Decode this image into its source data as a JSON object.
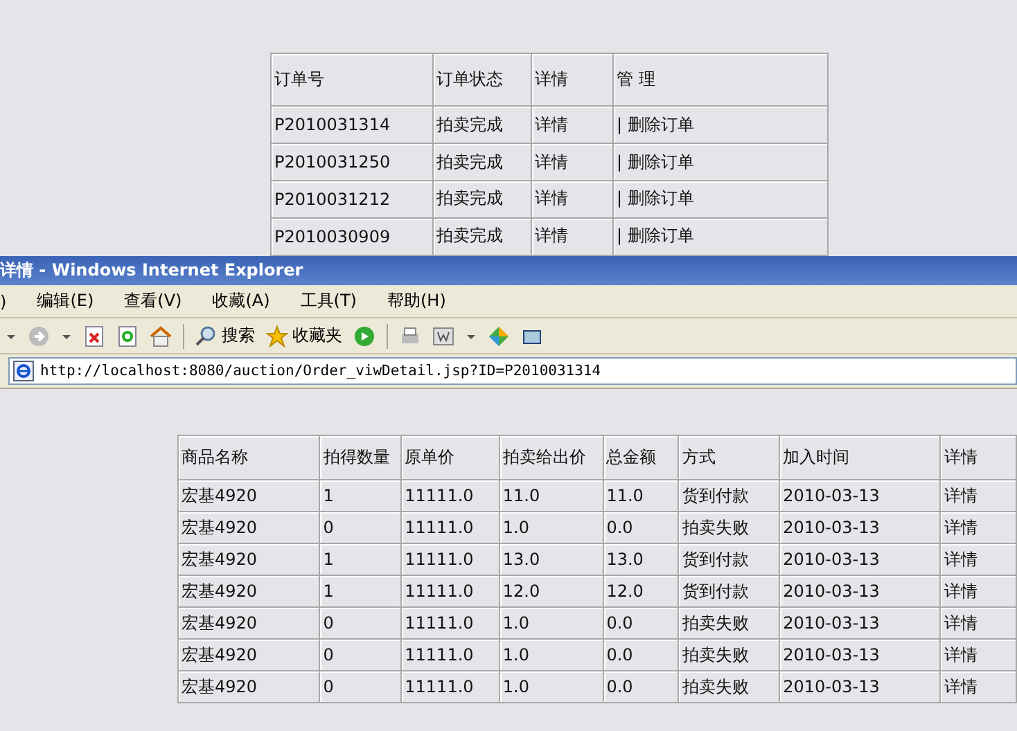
{
  "orders_table": {
    "columns": [
      "订单号",
      "订单状态",
      "详情",
      "管 理"
    ],
    "rows": [
      {
        "order_no": "P2010031314",
        "status": "拍卖完成",
        "detail": "详情",
        "manage": "| 删除订单"
      },
      {
        "order_no": "P2010031250",
        "status": "拍卖完成",
        "detail": "详情",
        "manage": "| 删除订单"
      },
      {
        "order_no": "P2010031212",
        "status": "拍卖完成",
        "detail": "详情",
        "manage": "| 删除订单"
      },
      {
        "order_no": "P2010030909",
        "status": "拍卖完成",
        "detail": "详情",
        "manage": "| 删除订单"
      }
    ]
  },
  "window": {
    "title": "详情 - Windows Internet Explorer"
  },
  "menu": [
    ")",
    "编辑(E)",
    "查看(V)",
    "收藏(A)",
    "工具(T)",
    "帮助(H)"
  ],
  "toolbar": {
    "search": "搜索",
    "favorites": "收藏夹"
  },
  "address": "http://localhost:8080/auction/Order_viwDetail.jsp?ID=P2010031314",
  "detail_table": {
    "columns": [
      "商品名称",
      "拍得数量",
      "原单价",
      "拍卖给出价",
      "总金额",
      "方式",
      "加入时间",
      "详情"
    ],
    "rows": [
      [
        "宏基4920",
        "1",
        "11111.0",
        "11.0",
        "11.0",
        "货到付款",
        "2010-03-13",
        "详情"
      ],
      [
        "宏基4920",
        "0",
        "11111.0",
        "1.0",
        "0.0",
        "拍卖失败",
        "2010-03-13",
        "详情"
      ],
      [
        "宏基4920",
        "1",
        "11111.0",
        "13.0",
        "13.0",
        "货到付款",
        "2010-03-13",
        "详情"
      ],
      [
        "宏基4920",
        "1",
        "11111.0",
        "12.0",
        "12.0",
        "货到付款",
        "2010-03-13",
        "详情"
      ],
      [
        "宏基4920",
        "0",
        "11111.0",
        "1.0",
        "0.0",
        "拍卖失败",
        "2010-03-13",
        "详情"
      ],
      [
        "宏基4920",
        "0",
        "11111.0",
        "1.0",
        "0.0",
        "拍卖失败",
        "2010-03-13",
        "详情"
      ],
      [
        "宏基4920",
        "0",
        "11111.0",
        "1.0",
        "0.0",
        "拍卖失败",
        "2010-03-13",
        "详情"
      ]
    ]
  }
}
